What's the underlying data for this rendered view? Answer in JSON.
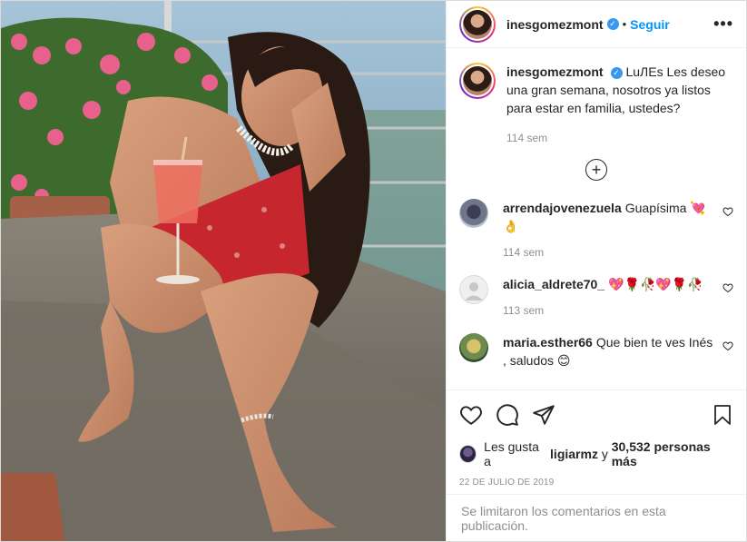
{
  "post": {
    "username": "inesgomezmont",
    "follow_label": "Seguir",
    "more_label": "•••",
    "separator": "•"
  },
  "caption": {
    "username": "inesgomezmont",
    "text": "LuЛEs Les deseo una gran semana, nosotros ya listos para estar en familia, ustedes?",
    "time": "114 sem"
  },
  "load_more_label": "+",
  "comments": [
    {
      "username": "arrendajovenezuela",
      "text": "Guapísima 💘👌",
      "time": "114 sem"
    },
    {
      "username": "alicia_aldrete70_",
      "text": "💖🌹🥀💖🌹🥀",
      "time": "113 sem"
    },
    {
      "username": "maria.esther66",
      "text": "Que bien te ves Inés , saludos 😊",
      "time": ""
    }
  ],
  "likes": {
    "prefix": "Les gusta a",
    "user": "ligiarmz",
    "middle": "y",
    "others": "30,532 personas más"
  },
  "date": "22 DE JULIO DE 2019",
  "comments_limited": "Se limitaron los comentarios en esta publicación.",
  "icons": [
    "heart-icon",
    "comment-icon",
    "share-icon",
    "bookmark-icon",
    "plus-circle-icon",
    "verified-icon",
    "more-icon"
  ],
  "colors": {
    "link": "#0095f6",
    "verified": "#3897f0",
    "muted": "#8e8e8e"
  }
}
